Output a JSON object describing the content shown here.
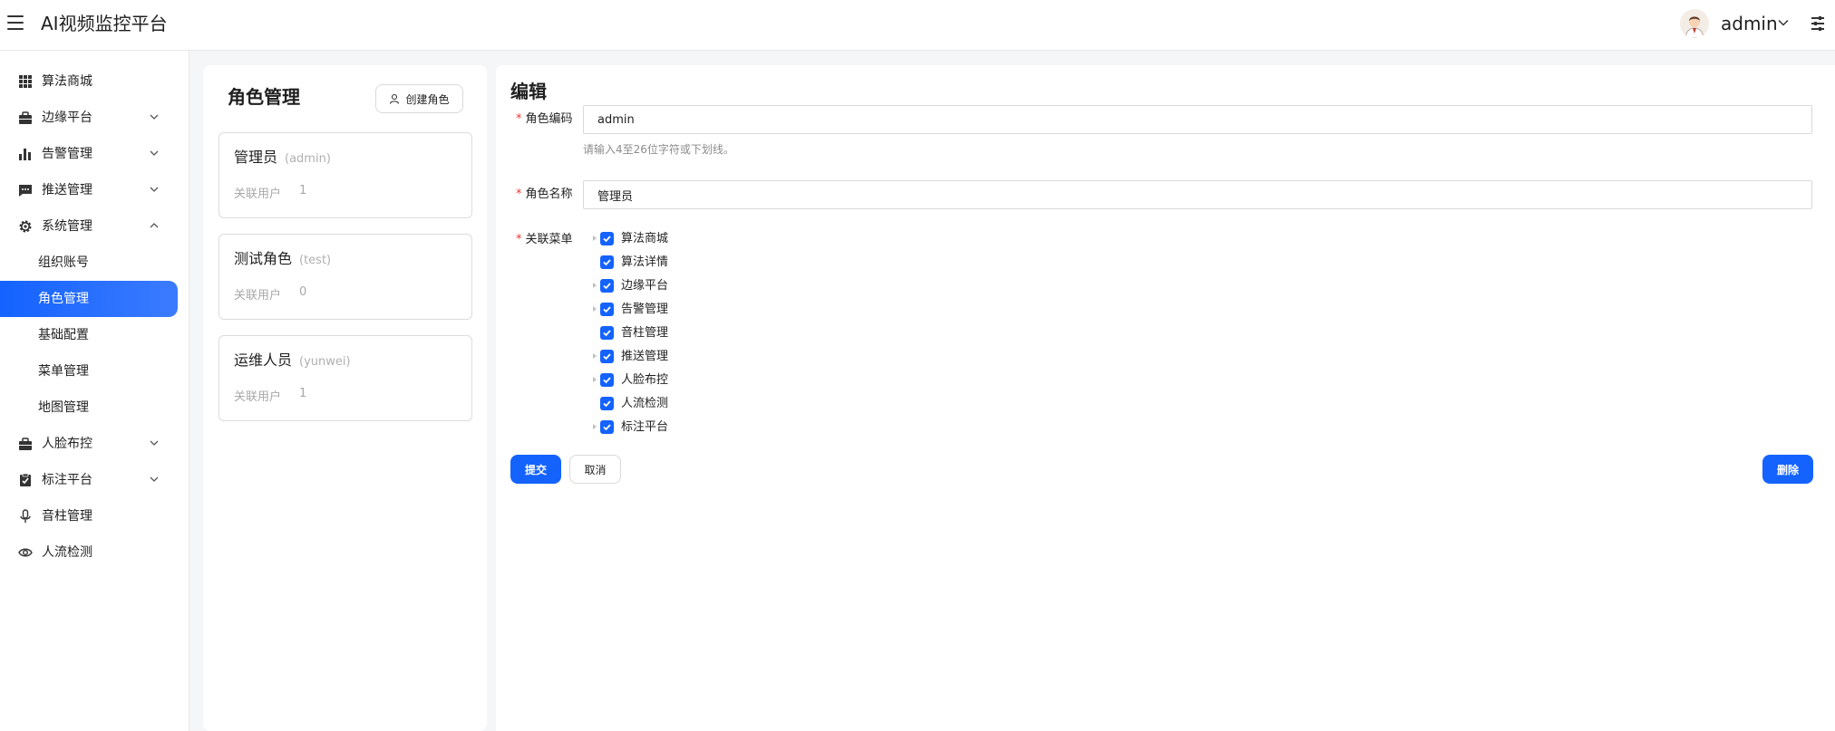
{
  "header": {
    "app_title": "AI视频监控平台",
    "user_name": "admin"
  },
  "sidebar": {
    "items": [
      {
        "label": "算法商城",
        "icon": "grid-icon",
        "has_arrow": false
      },
      {
        "label": "边缘平台",
        "icon": "briefcase-icon",
        "has_arrow": true
      },
      {
        "label": "告警管理",
        "icon": "bar-chart-icon",
        "has_arrow": true
      },
      {
        "label": "推送管理",
        "icon": "message-icon",
        "has_arrow": true
      },
      {
        "label": "系统管理",
        "icon": "gear-icon",
        "has_arrow": true,
        "expanded": true
      },
      {
        "label": "组织账号",
        "sub": true
      },
      {
        "label": "角色管理",
        "sub": true,
        "active": true
      },
      {
        "label": "基础配置",
        "sub": true
      },
      {
        "label": "菜单管理",
        "sub": true
      },
      {
        "label": "地图管理",
        "sub": true
      },
      {
        "label": "人脸布控",
        "icon": "briefcase-icon",
        "has_arrow": true
      },
      {
        "label": "标注平台",
        "icon": "clipboard-check-icon",
        "has_arrow": true
      },
      {
        "label": "音柱管理",
        "icon": "microphone-icon",
        "has_arrow": false
      },
      {
        "label": "人流检测",
        "icon": "eye-icon",
        "has_arrow": false
      }
    ]
  },
  "roles": {
    "title": "角色管理",
    "create_button": "创建角色",
    "users_label": "关联用户",
    "list": [
      {
        "name": "管理员",
        "code": "(admin)",
        "users": "1"
      },
      {
        "name": "测试角色",
        "code": "(test)",
        "users": "0"
      },
      {
        "name": "运维人员",
        "code": "(yunwei)",
        "users": "1"
      }
    ]
  },
  "edit": {
    "title": "编辑",
    "code_label": "角色编码",
    "code_value": "admin",
    "code_hint": "请输入4至26位字符或下划线。",
    "name_label": "角色名称",
    "name_value": "管理员",
    "menu_label": "关联菜单",
    "menu_tree": [
      {
        "label": "算法商城",
        "expandable": true,
        "checked": true
      },
      {
        "label": "算法详情",
        "expandable": false,
        "checked": true
      },
      {
        "label": "边缘平台",
        "expandable": true,
        "checked": true
      },
      {
        "label": "告警管理",
        "expandable": true,
        "checked": true
      },
      {
        "label": "音柱管理",
        "expandable": false,
        "checked": true
      },
      {
        "label": "推送管理",
        "expandable": true,
        "checked": true
      },
      {
        "label": "人脸布控",
        "expandable": true,
        "checked": true
      },
      {
        "label": "人流检测",
        "expandable": false,
        "checked": true
      },
      {
        "label": "标注平台",
        "expandable": true,
        "checked": true
      }
    ],
    "submit_label": "提交",
    "cancel_label": "取消",
    "delete_label": "删除"
  },
  "colors": {
    "primary": "#1463ff",
    "required": "#e53935"
  }
}
